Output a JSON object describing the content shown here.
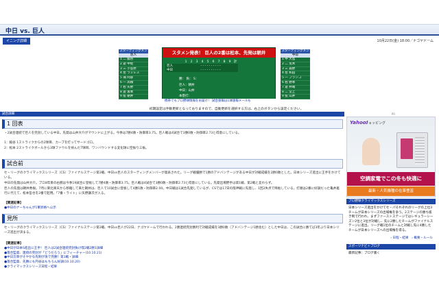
{
  "header": {
    "title": "中日 vs. 巨人",
    "tab": "イニング詳細",
    "date": "10月22日(金) 18:00／ナゴヤドーム"
  },
  "lineup_left": {
    "heading": "スターティングメンバー",
    "team": "巨人",
    "players": [
      "1 二 脇谷",
      "2 遊 中佐",
      "3 三 小笠原",
      "4 左 ラミレス",
      "5 捕 阿部",
      "6 一 高橋",
      "7 右 矢野",
      "8 遊 坂本",
      "9 投 朝井"
    ]
  },
  "lineup_right": {
    "heading": "スターティングメンバー",
    "team": "中日",
    "players": [
      "1 中 大島",
      "2 二 荒木",
      "3 三 森野",
      "4 左 和田",
      "5 一 ブランコ",
      "6 右 野本",
      "7 遊 井端",
      "8 二 堂上",
      "9 投 山井"
    ]
  },
  "scoreboard": {
    "banner": "スタメン発表！ 巨人の2番は松本、先発は朝井",
    "innings": [
      "1",
      "2",
      "3",
      "4",
      "5",
      "6",
      "7",
      "8",
      "9",
      "計"
    ],
    "teams": [
      {
        "name": "巨人",
        "marks": "- - - - - - - - - -"
      },
      {
        "name": "中日",
        "marks": "- - - - - - - - - -"
      }
    ],
    "pitcher_win": "勝：",
    "pitcher_loss": "負：",
    "save": "S：",
    "giants_pitcher": "巨人：朝井",
    "chunichi_pitcher": "中日：山井",
    "hr": "本塁打："
  },
  "links": {
    "bar": "携帯でもプロ野球情報をお届け！ 試合速報は1球速報メールも"
  },
  "note": "初期設定は手動更新となっておりますので、自動更新を選択する方は、右上のボタンから設定ください。",
  "main": {
    "section": "試合詳細",
    "inning_heading": "1 回表",
    "inning_lines": [
      "・2試合連続で巨人を完封している中日。先発は山井大介がマウンドに上がる。今季は7勝4敗・防御率3.75。巨人戦は4試合で3勝0敗・防御率2.73と得意にしている。",
      "1：脇谷 1ストライクからの2球目、カーブを打ってサードゴロ。",
      "2：松本 2ストライクボールから3球ファウルを挟んだ7球目、ワンバウンドする変化球に空振り三振。"
    ],
    "pre_heading": "試合前",
    "pre_lines": [
      "セ・リーグのクライマックスシリーズ（CS）ファイナルステージ第3戦、中日vs巨人のスターティングメンバーが発表された。リーグ戦優勝で1勝のアドバンテージがある中日が対戦成績を2勝0敗とした。日本シリーズ進出に王手をかけている。",
      "中日の先発は山井大介。プロ8年目の右腕は今季19試合に登板して7勝4敗・防御率3.75。巨人戦は4試合で3勝0敗・防御率2.73と得意にしている。先発出場野手は第1戦、第2戦と変わらず。",
      "巨人の先発は朝井秀樹。7月に東北楽天から移籍して来た朝井は、巨人で10試合に登板して4勝1敗・防御率2.00。中日戦は1試合先発しているが、CSでは17日の阪神戦に先発し、1回2失点で降板している。打順は2番に好調だった亀井義行に代えて、松本哲也を2番で起用。「7番・ライト」に矢野謙次が入る。"
    ],
    "pre_rel_title": "【関連記事】",
    "pre_rel": [
      "●中日のナーちゃんが1軍昇格へ公示"
    ],
    "preview_heading": "見所",
    "preview_lines": [
      "セ・リーグのクライマックスシリーズ（CS）ファイナルステージ第3戦、中日vs巨人が22日、ナゴヤドームで行われる。2勝連続完封勝利で対戦成績を3勝0敗（アドバンテージ1勝含む）とした中日は、この試合に勝てば3年ぶり日本シリーズ進出が決まる。"
    ],
    "preview_rel_title": "【関連記事】",
    "preview_rel": [
      "●中日が日本S進出に王手！ 巨人は2試合連続完封負け喫2戦2勝1詳細",
      "●落合監督、連続の完封が「どうだろう」にフィーチャー(10.10.21)",
      "●中日方衆がそやかな先制が攻で完勝！第1戦・詳細",
      "●落合監督、先勝にも円谷はもちろん好調(10.10.20)",
      "●クライマックスシリーズ日程・結果"
    ]
  },
  "sidebar": {
    "pr_label": "PR",
    "ad_brand": "Yahoo!",
    "ad_tag": "ショッピング",
    "ad_title": "空調家電でこの冬も快適に",
    "ad_sub": "最新・人気機種の在庫豊富",
    "card_heading": "プロ野球クライマックスシリーズ",
    "card_text": "日本シリーズ進出をかけてセ・パそれぞれのリーグの上位3チームが日本シリーズの出場権を争う。2ステージの勝ち抜き制で行われ、まずファーストステージではレギュラーシーズン2位と3位が対戦し、先に2勝したチームがファイナルステージに進出。リーグ戦1位のチームと対戦し先に4勝したチームが日本シリーズへの出場権を得る。",
    "card_links": [
      "› 日程・結果",
      "› 概要・ルール"
    ],
    "blog_heading": "スポーツナビ＋ブログ",
    "blog_text": "最新記事：ブログ書く"
  }
}
